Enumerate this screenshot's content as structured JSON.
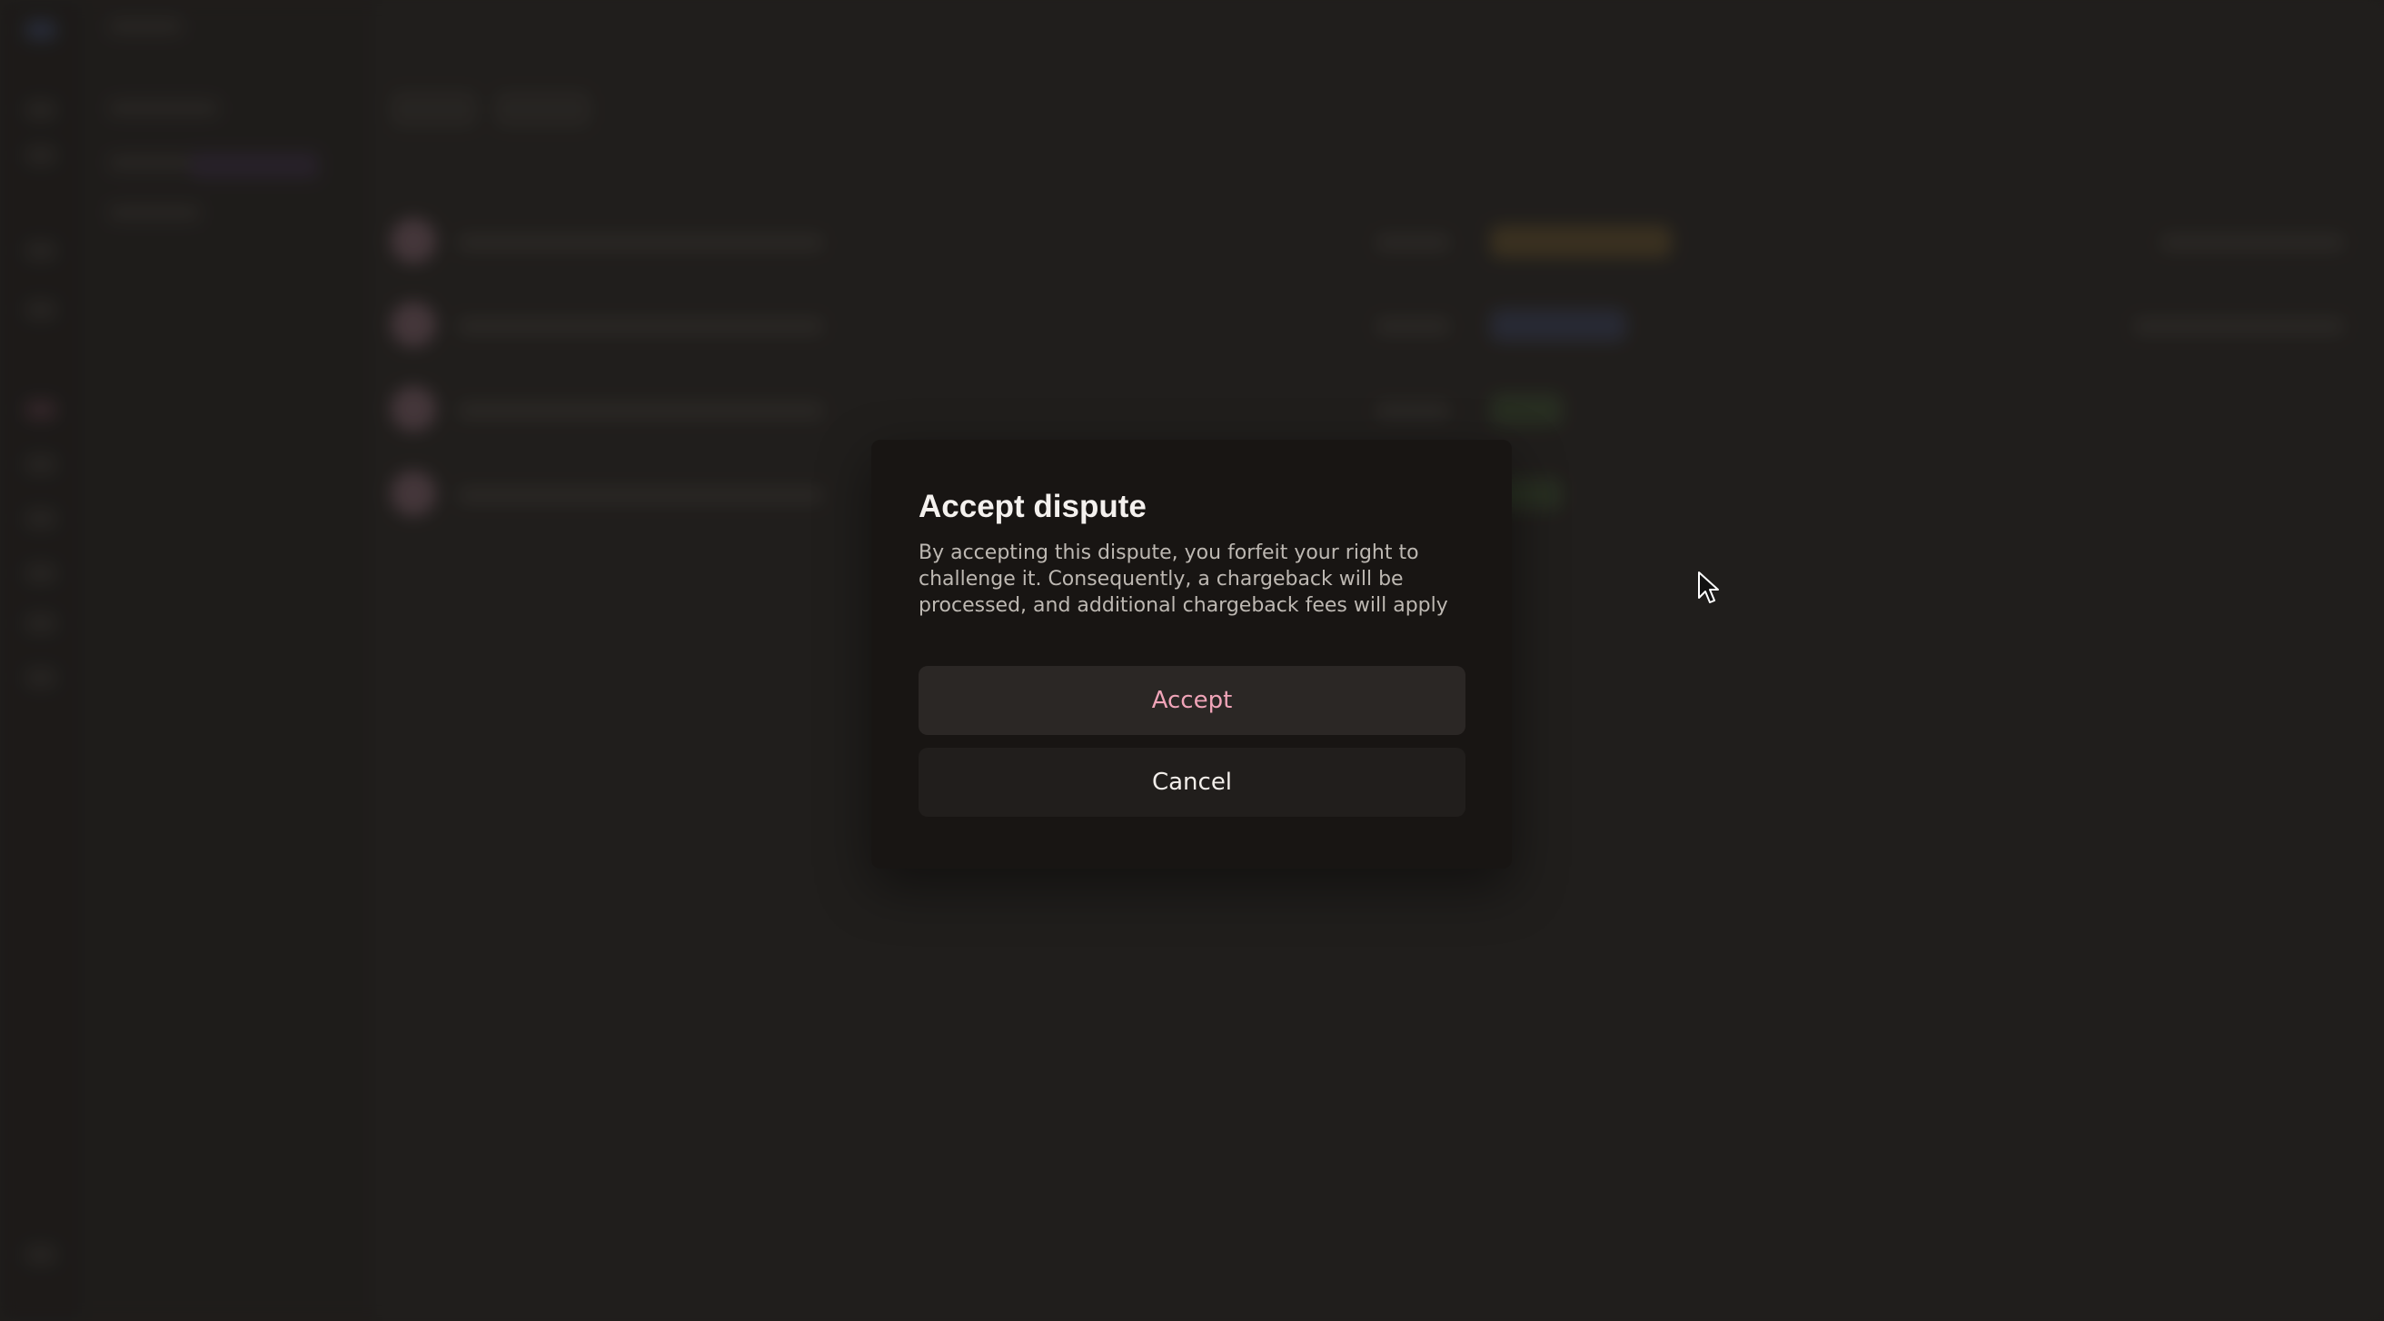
{
  "modal": {
    "title": "Accept dispute",
    "description": "By accepting this dispute, you forfeit your right to challenge it. Consequently, a chargeback will be processed, and additional chargeback fees will apply",
    "accept_label": "Accept",
    "cancel_label": "Cancel"
  },
  "colors": {
    "accent": "#f0a4b8",
    "modal_background": "#181513",
    "page_background": "#262421"
  },
  "icons": {
    "cursor": "mouse-pointer-icon"
  }
}
